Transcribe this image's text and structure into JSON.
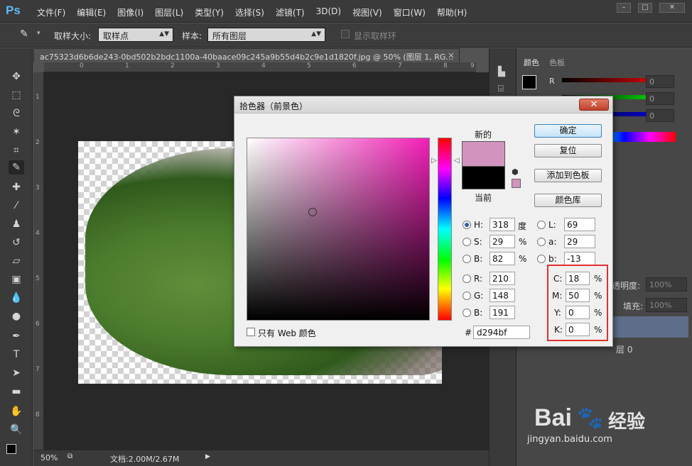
{
  "app": {
    "logo": "Ps",
    "menu": [
      "文件(F)",
      "编辑(E)",
      "图像(I)",
      "图层(L)",
      "类型(Y)",
      "选择(S)",
      "滤镜(T)",
      "3D(D)",
      "视图(V)",
      "窗口(W)",
      "帮助(H)"
    ]
  },
  "options": {
    "sample_size_label": "取样大小:",
    "sample_size_value": "取样点",
    "sample_label": "样本:",
    "sample_value": "所有图层",
    "show_ring_label": "显示取样环"
  },
  "document": {
    "tab_title": "ac75323d6b6de243-0bd502b2bdc1100a-40baace09c245a9b55d4b2c9e1d1820f.jpg @ 50% (图层 1, RG...",
    "ruler_top": [
      "0",
      "1",
      "2",
      "3",
      "4",
      "5",
      "6",
      "7",
      "8",
      "9"
    ],
    "ruler_left": [
      "1",
      "2",
      "3",
      "4",
      "5",
      "6",
      "7",
      "8"
    ],
    "zoom": "50%",
    "doc_info": "文档:2.00M/2.67M"
  },
  "right_panel": {
    "tab_color": "颜色",
    "tab_swatches": "色板",
    "r_label": "R",
    "r_value": "0",
    "g_value": "0",
    "b_value": "0",
    "opacity_label": "透明度:",
    "opacity_value": "100%",
    "fill_label": "填充:",
    "fill_value": "100%",
    "layer_label": "层 0"
  },
  "dialog": {
    "title": "拾色器（前景色）",
    "new_label": "新的",
    "current_label": "当前",
    "ok": "确定",
    "reset": "复位",
    "add_swatch": "添加到色板",
    "color_libraries": "颜色库",
    "only_web": "只有 Web 颜色",
    "hex": "d294bf",
    "hsb": {
      "H": "318",
      "S": "29",
      "B": "82"
    },
    "rgb": {
      "R": "210",
      "G": "148",
      "B": "191"
    },
    "lab": {
      "L": "69",
      "a": "29",
      "b": "-13"
    },
    "cmyk": {
      "C": "18",
      "M": "50",
      "Y": "0",
      "K": "0"
    },
    "unit_degree": "度",
    "unit_percent": "%",
    "new_color": "#d294bf",
    "current_color": "#000000"
  },
  "watermark": {
    "brand": "Bai",
    "brand2": "经验",
    "url": "jingyan.baidu.com"
  }
}
